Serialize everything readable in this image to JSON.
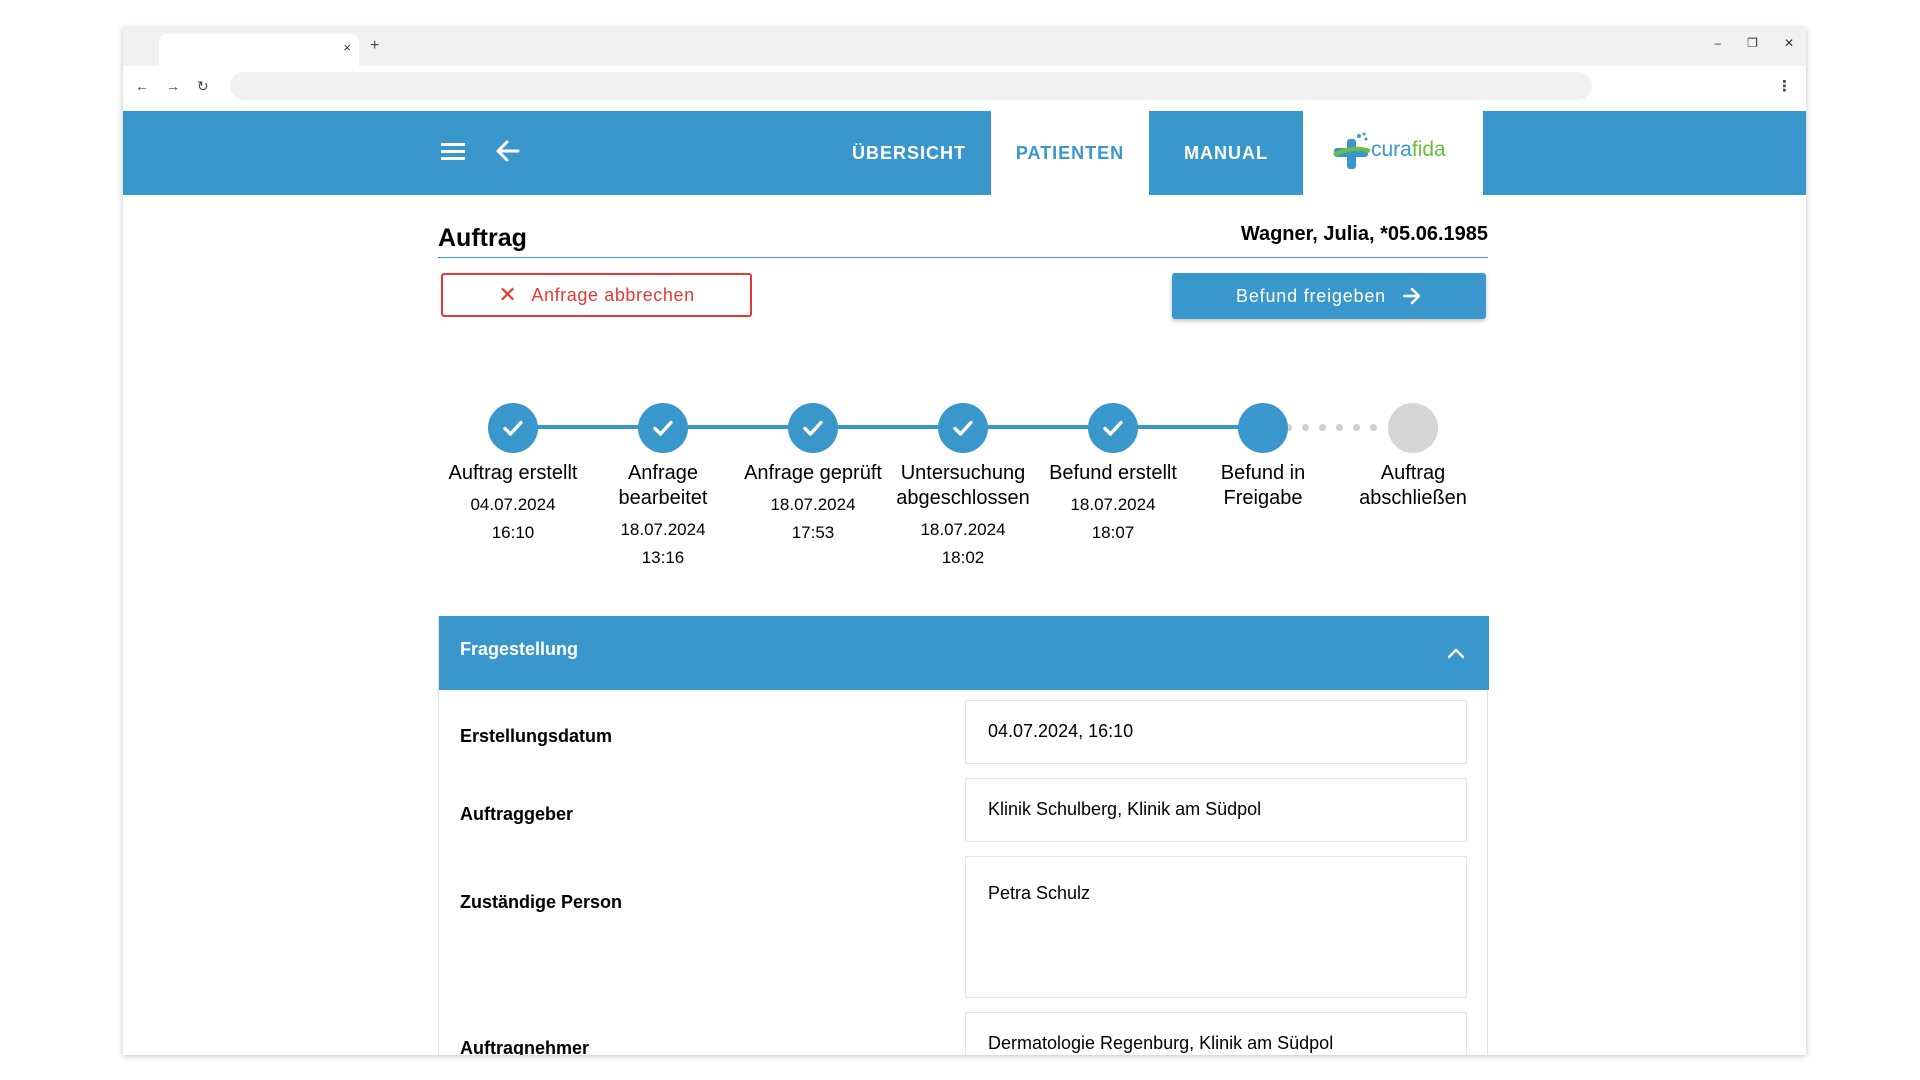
{
  "browser": {
    "tab_close": "×",
    "new_tab": "+",
    "window_controls": [
      "–",
      "❐",
      "✕"
    ],
    "nav": {
      "back": "←",
      "forward": "→",
      "reload": "↻"
    },
    "menu": "⋮"
  },
  "header": {
    "nav_tabs": [
      {
        "label": "ÜBERSICHT",
        "active": false
      },
      {
        "label": "PATIENTEN",
        "active": true
      },
      {
        "label": "MANUAL",
        "active": false
      }
    ],
    "logo": {
      "part1": "cura",
      "part2": "fida"
    }
  },
  "page": {
    "title": "Auftrag",
    "patient": "Wagner, Julia, *05.06.1985",
    "cancel_button": {
      "icon": "close-icon",
      "label": "Anfrage abbrechen"
    },
    "release_button": {
      "label": "Befund freigeben",
      "icon": "arrow-right-icon"
    }
  },
  "stepper": {
    "steps": [
      {
        "label": "Auftrag erstellt",
        "date": "04.07.2024",
        "time": "16:10",
        "status": "done"
      },
      {
        "label": "Anfrage bearbeitet",
        "date": "18.07.2024",
        "time": "13:16",
        "status": "done"
      },
      {
        "label": "Anfrage geprüft",
        "date": "18.07.2024",
        "time": "17:53",
        "status": "done"
      },
      {
        "label": "Untersuchung abgeschlossen",
        "date": "18.07.2024",
        "time": "18:02",
        "status": "done"
      },
      {
        "label": "Befund erstellt",
        "date": "18.07.2024",
        "time": "18:07",
        "status": "done"
      },
      {
        "label": "Befund in Freigabe",
        "date": "",
        "time": "",
        "status": "current"
      },
      {
        "label": "Auftrag abschließen",
        "date": "",
        "time": "",
        "status": "pending"
      }
    ]
  },
  "panel": {
    "title": "Fragestellung",
    "fields": [
      {
        "label": "Erstellungsdatum",
        "value": "04.07.2024, 16:10"
      },
      {
        "label": "Auftraggeber",
        "value": "Klinik Schulberg, Klinik am Südpol"
      },
      {
        "label": "Zuständige Person",
        "value": "Petra Schulz"
      },
      {
        "label": "Auftragnehmer",
        "value": "Dermatologie Regenburg, Klinik am Südpol"
      }
    ]
  },
  "colors": {
    "primary": "#3a97cb",
    "danger": "#e53935",
    "pending": "#d6d6d6",
    "logo_green": "#6bbf3b"
  }
}
